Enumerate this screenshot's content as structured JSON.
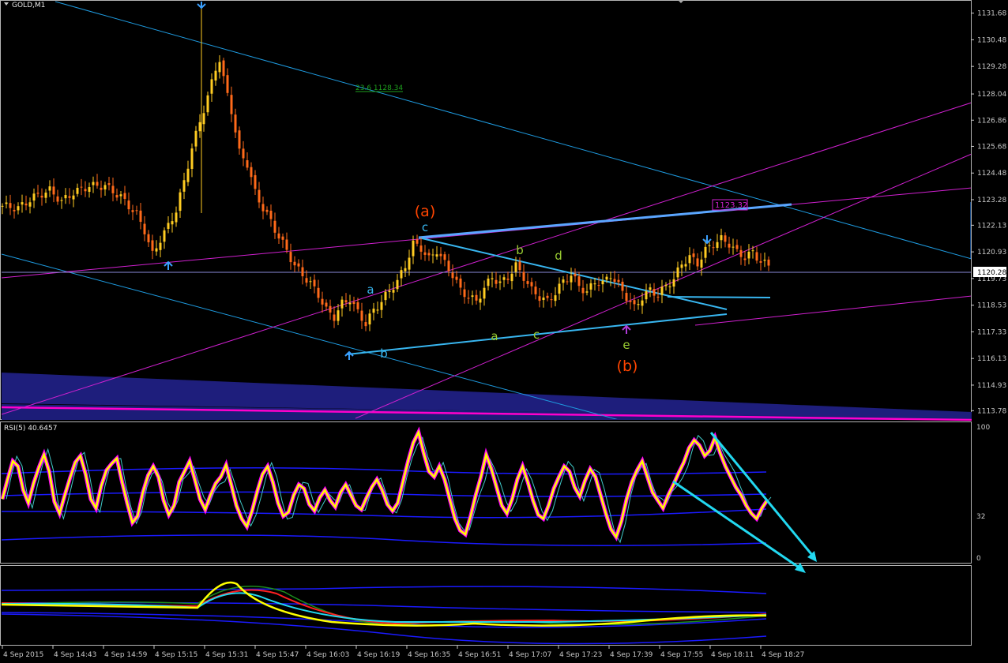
{
  "header": {
    "symbol_title": "GOLD,M1",
    "rsi_title": "RSI(5) 40.6457"
  },
  "colors": {
    "background": "#000000",
    "axis": "#c8c8c8",
    "bull": "#ffcc22",
    "bear": "#ff6a1a",
    "channel": "#1e9be0",
    "fib_magenta": "#d020d0",
    "wave_cyan": "#38b6f0",
    "wave_green": "#9acd32",
    "wave_red": "#ff4500",
    "rsi_main": "#ffff00",
    "rsi_shadow": "#ff00ff",
    "band_blue": "#1a1aff",
    "arrow_cyan": "#22d8f0",
    "cloud": "#1c1c78"
  },
  "chart_data": [
    {
      "type": "candlestick",
      "title": "GOLD,M1",
      "ylim": [
        1113.4,
        1132.2
      ],
      "y_ticks": [
        1131.68,
        1130.48,
        1129.28,
        1128.04,
        1126.86,
        1125.68,
        1124.48,
        1123.28,
        1122.13,
        1120.93,
        1119.73,
        1118.53,
        1117.33,
        1116.13,
        1114.93,
        1113.78
      ],
      "current_price": "1120.28",
      "fib_label": "23.6 1128.34",
      "price_box": "1123.32",
      "x_labels": [
        "4 Sep 2015",
        "4 Sep 14:43",
        "4 Sep 14:59",
        "4 Sep 15:15",
        "4 Sep 15:31",
        "4 Sep 15:47",
        "4 Sep 16:03",
        "4 Sep 16:19",
        "4 Sep 16:35",
        "4 Sep 16:51",
        "4 Sep 17:07",
        "4 Sep 17:23",
        "4 Sep 17:39",
        "4 Sep 17:55",
        "4 Sep 18:11",
        "4 Sep 18:27"
      ],
      "close_path": [
        [
          0,
          1123.0
        ],
        [
          4,
          1122.9
        ],
        [
          8,
          1123.4
        ],
        [
          12,
          1123.7
        ],
        [
          15,
          1123.2
        ],
        [
          18,
          1123.6
        ],
        [
          22,
          1123.9
        ],
        [
          26,
          1123.9
        ],
        [
          30,
          1123.4
        ],
        [
          34,
          1122.6
        ],
        [
          36,
          1121.9
        ],
        [
          38,
          1120.8
        ],
        [
          40,
          1121.5
        ],
        [
          42,
          1122.1
        ],
        [
          44,
          1122.8
        ],
        [
          46,
          1124.1
        ],
        [
          48,
          1125.6
        ],
        [
          50,
          1126.8
        ],
        [
          52,
          1127.9
        ],
        [
          54,
          1129.2
        ],
        [
          55,
          1129.6
        ],
        [
          56,
          1128.7
        ],
        [
          58,
          1127.3
        ],
        [
          60,
          1125.4
        ],
        [
          62,
          1124.9
        ],
        [
          64,
          1123.6
        ],
        [
          66,
          1122.9
        ],
        [
          68,
          1122.3
        ],
        [
          70,
          1121.6
        ],
        [
          72,
          1121.0
        ],
        [
          74,
          1120.3
        ],
        [
          76,
          1119.9
        ],
        [
          78,
          1119.5
        ],
        [
          80,
          1119.0
        ],
        [
          82,
          1118.3
        ],
        [
          84,
          1118.0
        ],
        [
          86,
          1118.6
        ],
        [
          88,
          1118.8
        ],
        [
          90,
          1118.2
        ],
        [
          92,
          1117.7
        ],
        [
          94,
          1118.3
        ],
        [
          96,
          1118.7
        ],
        [
          98,
          1119.2
        ],
        [
          100,
          1119.6
        ],
        [
          102,
          1120.3
        ],
        [
          104,
          1121.3
        ],
        [
          106,
          1121.1
        ],
        [
          108,
          1120.6
        ],
        [
          110,
          1121.0
        ],
        [
          112,
          1120.4
        ],
        [
          114,
          1119.9
        ],
        [
          116,
          1119.2
        ],
        [
          118,
          1118.9
        ],
        [
          120,
          1118.7
        ],
        [
          122,
          1119.3
        ],
        [
          124,
          1119.8
        ],
        [
          126,
          1119.5
        ],
        [
          128,
          1119.8
        ],
        [
          130,
          1120.3
        ],
        [
          132,
          1119.8
        ],
        [
          134,
          1119.2
        ],
        [
          136,
          1118.9
        ],
        [
          138,
          1118.7
        ],
        [
          140,
          1119.1
        ],
        [
          142,
          1119.6
        ],
        [
          144,
          1119.9
        ],
        [
          146,
          1119.4
        ],
        [
          148,
          1119.1
        ],
        [
          150,
          1119.6
        ],
        [
          152,
          1119.5
        ],
        [
          154,
          1119.9
        ],
        [
          156,
          1119.4
        ],
        [
          158,
          1118.9
        ],
        [
          160,
          1118.4
        ],
        [
          162,
          1118.9
        ],
        [
          164,
          1119.2
        ],
        [
          166,
          1119.0
        ],
        [
          168,
          1119.4
        ],
        [
          170,
          1119.7
        ],
        [
          172,
          1120.4
        ],
        [
          174,
          1120.7
        ],
        [
          176,
          1120.4
        ],
        [
          178,
          1121.0
        ],
        [
          180,
          1121.3
        ],
        [
          182,
          1121.5
        ],
        [
          184,
          1121.3
        ],
        [
          186,
          1120.9
        ],
        [
          188,
          1120.7
        ],
        [
          190,
          1120.9
        ],
        [
          192,
          1120.5
        ],
        [
          194,
          1120.3
        ]
      ],
      "wave_labels": {
        "a1": "a",
        "b1": "b",
        "c1": "c",
        "A": "(a)",
        "a2": "a",
        "b2": "b",
        "c2": "c",
        "d2": "d",
        "e2": "e",
        "B": "(b)"
      }
    },
    {
      "type": "line",
      "title": "RSI(5) 40.6457",
      "ylim": [
        0,
        100
      ],
      "y_ticks": [
        100,
        32,
        0
      ],
      "rsi_values": [
        45,
        60,
        74,
        70,
        52,
        42,
        57,
        69,
        79,
        66,
        43,
        34,
        48,
        61,
        73,
        78,
        64,
        45,
        38,
        55,
        67,
        72,
        76,
        58,
        42,
        27,
        32,
        50,
        63,
        70,
        62,
        44,
        33,
        40,
        58,
        66,
        74,
        60,
        45,
        37,
        48,
        57,
        62,
        71,
        56,
        40,
        30,
        24,
        36,
        51,
        64,
        70,
        58,
        42,
        32,
        35,
        48,
        56,
        53,
        41,
        36,
        46,
        52,
        44,
        39,
        50,
        56,
        48,
        40,
        37,
        46,
        54,
        60,
        52,
        41,
        36,
        42,
        58,
        74,
        88,
        96,
        80,
        66,
        62,
        70,
        60,
        45,
        30,
        21,
        18,
        32,
        48,
        62,
        79,
        68,
        54,
        40,
        34,
        45,
        60,
        70,
        58,
        44,
        33,
        30,
        40,
        53,
        62,
        70,
        66,
        54,
        47,
        59,
        68,
        62,
        48,
        34,
        22,
        16,
        28,
        45,
        58,
        67,
        74,
        62,
        50,
        44,
        38,
        48,
        56,
        65,
        73,
        84,
        90,
        86,
        78,
        82,
        92,
        80,
        70,
        62,
        54,
        48,
        40,
        34,
        30,
        38,
        44
      ]
    }
  ]
}
